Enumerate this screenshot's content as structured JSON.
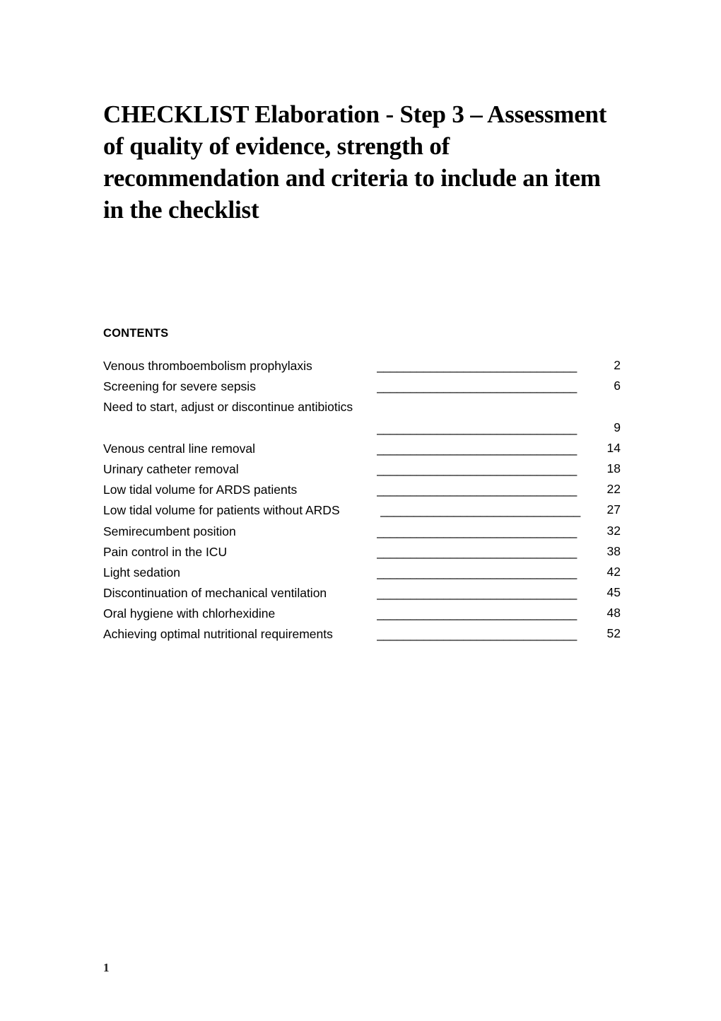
{
  "document": {
    "title": "CHECKLIST Elaboration - Step 3 – Assessment of quality of evidence, strength of recommendation and criteria to include an item in the checklist",
    "contents_heading": "CONTENTS",
    "footer_page_number": "1"
  },
  "toc": {
    "leader_text": "______________________________",
    "entries": [
      {
        "label": "Venous thromboembolism prophylaxis",
        "page": "2",
        "wraps": false,
        "leader_shift": false
      },
      {
        "label": "Screening for severe sepsis",
        "page": "6",
        "wraps": false,
        "leader_shift": false
      },
      {
        "label": "Need to start, adjust or discontinue antibiotics",
        "page": "9",
        "wraps": true,
        "leader_shift": false
      },
      {
        "label": "Venous central line removal",
        "page": "14",
        "wraps": false,
        "leader_shift": false
      },
      {
        "label": "Urinary catheter removal",
        "page": "18",
        "wraps": false,
        "leader_shift": false
      },
      {
        "label": "Low tidal volume for ARDS patients",
        "page": "22",
        "wraps": false,
        "leader_shift": false
      },
      {
        "label": "Low tidal volume for patients without ARDS",
        "page": "27",
        "wraps": false,
        "leader_shift": true
      },
      {
        "label": "Semirecumbent position",
        "page": "32",
        "wraps": false,
        "leader_shift": false
      },
      {
        "label": "Pain control in the ICU",
        "page": "38",
        "wraps": false,
        "leader_shift": false
      },
      {
        "label": "Light sedation",
        "page": "42",
        "wraps": false,
        "leader_shift": false
      },
      {
        "label": "Discontinuation of mechanical ventilation",
        "page": "45",
        "wraps": false,
        "leader_shift": false
      },
      {
        "label": "Oral hygiene with chlorhexidine",
        "page": "48",
        "wraps": false,
        "leader_shift": false
      },
      {
        "label": "Achieving optimal nutritional requirements",
        "page": "52",
        "wraps": false,
        "leader_shift": false
      }
    ]
  }
}
